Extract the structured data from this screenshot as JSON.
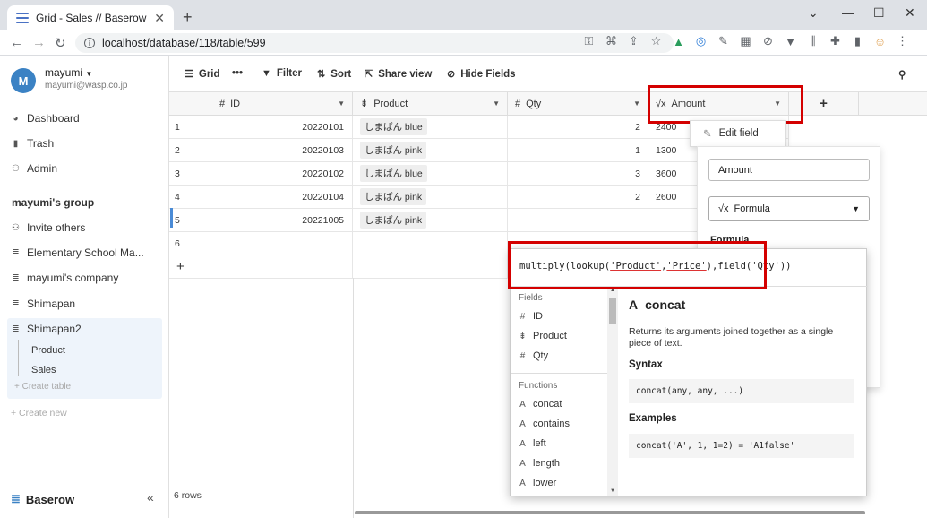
{
  "browser": {
    "tab_title": "Grid - Sales // Baserow",
    "url": "localhost/database/118/table/599"
  },
  "sidebar": {
    "user_name": "mayumi",
    "user_email": "mayumi@wasp.co.jp",
    "avatar_letter": "M",
    "items": [
      {
        "label": "Dashboard",
        "icon": "dashboard-icon"
      },
      {
        "label": "Trash",
        "icon": "trash-icon"
      },
      {
        "label": "Admin",
        "icon": "admin-icon"
      }
    ],
    "group_title": "mayumi's group",
    "group_items": [
      {
        "label": "Invite others",
        "icon": "users-icon"
      },
      {
        "label": "Elementary School Ma...",
        "icon": "database-icon"
      },
      {
        "label": "mayumi's company",
        "icon": "database-icon"
      },
      {
        "label": "Shimapan",
        "icon": "database-icon"
      },
      {
        "label": "Shimapan2",
        "icon": "database-icon"
      }
    ],
    "tables": [
      "Product",
      "Sales"
    ],
    "create_table": "+ Create table",
    "create_new": "+ Create new",
    "brand": "Baserow"
  },
  "toolbar": {
    "grid": "Grid",
    "filter": "Filter",
    "sort": "Sort",
    "share": "Share view",
    "hide": "Hide Fields"
  },
  "grid": {
    "columns": [
      "ID",
      "Product",
      "Qty",
      "Amount"
    ],
    "rows": [
      {
        "n": "1",
        "id": "20220101",
        "product": "しまぱん blue",
        "qty": "2",
        "amount": "2400"
      },
      {
        "n": "2",
        "id": "20220103",
        "product": "しまぱん pink",
        "qty": "1",
        "amount": "1300"
      },
      {
        "n": "3",
        "id": "20220102",
        "product": "しまぱん blue",
        "qty": "3",
        "amount": "3600"
      },
      {
        "n": "4",
        "id": "20220104",
        "product": "しまぱん pink",
        "qty": "2",
        "amount": "2600"
      },
      {
        "n": "5",
        "id": "20221005",
        "product": "しまぱん pink",
        "qty": "",
        "amount": ""
      },
      {
        "n": "6",
        "id": "",
        "product": "",
        "qty": "",
        "amount": ""
      }
    ],
    "row_count": "6 rows"
  },
  "context_menu": {
    "edit_field": "Edit field"
  },
  "field_form": {
    "name_value": "Amount",
    "type_value": "Formula",
    "formula_label": "Formula"
  },
  "formula_panel": {
    "expr_before": "multiply(lookup(",
    "expr_ul1": "'Product'",
    "expr_mid": ",",
    "expr_ul2": "'Price'",
    "expr_after": "),field('Qty'))",
    "fields_header": "Fields",
    "fields": [
      "ID",
      "Product",
      "Qty"
    ],
    "functions_header": "Functions",
    "functions": [
      "concat",
      "contains",
      "left",
      "length",
      "lower"
    ],
    "doc_title": "concat",
    "doc_desc": "Returns its arguments joined together as a single piece of text.",
    "syntax_header": "Syntax",
    "syntax": "concat(any, any, ...)",
    "examples_header": "Examples",
    "example": "concat('A', 1, 1=2) = 'A1false'"
  },
  "colors": {
    "highlight": "#d40000",
    "accent": "#3b82c4"
  }
}
